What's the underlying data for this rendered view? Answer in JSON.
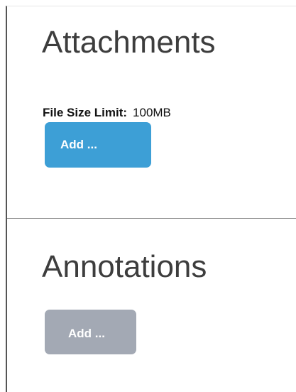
{
  "attachments": {
    "title": "Attachments",
    "file_size_label": "File Size Limit:",
    "file_size_value": "100MB",
    "add_button_label": "Add ..."
  },
  "annotations": {
    "title": "Annotations",
    "add_button_label": "Add ...",
    "add_button_state": "disabled"
  },
  "colors": {
    "primary_button": "#3d9fd6",
    "disabled_button": "#a3a9b4",
    "title_text": "#3d3d3d"
  }
}
